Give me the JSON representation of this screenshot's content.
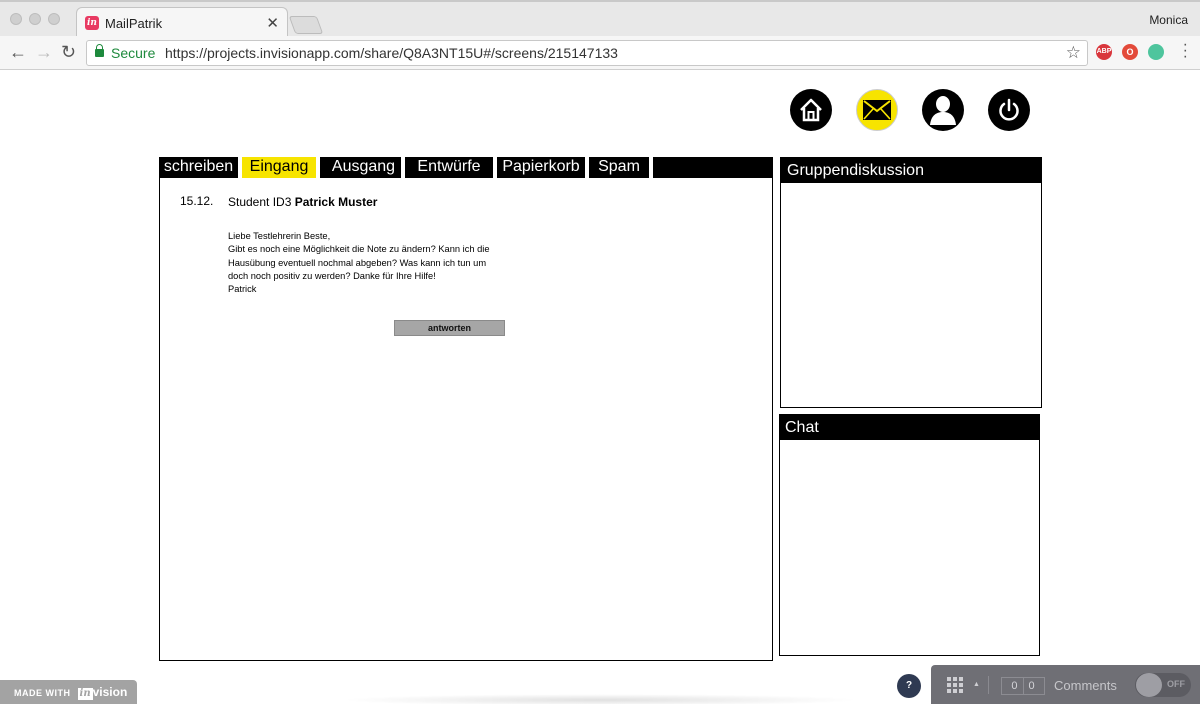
{
  "browser": {
    "tab_title": "MailPatrik",
    "tab_favicon": "in",
    "tab_close": "✕",
    "profile_name": "Monica",
    "secure_label": "Secure",
    "url": "https://projects.invisionapp.com/share/Q8A3NT15U#/screens/215147133",
    "extensions": [
      {
        "name": "adblock-plus",
        "label": "ABP",
        "color": "#d9363c"
      },
      {
        "name": "opera-extension",
        "label": "O",
        "color": "#e34a3a"
      },
      {
        "name": "grammarly-extension",
        "label": "",
        "color": "#4ec59d"
      }
    ]
  },
  "app": {
    "top_icons": [
      {
        "name": "home-icon",
        "active": false
      },
      {
        "name": "mail-icon",
        "active": true
      },
      {
        "name": "user-icon",
        "active": false
      },
      {
        "name": "power-icon",
        "active": false
      }
    ],
    "mail_tabs": [
      "schreiben",
      "Eingang",
      "Ausgang",
      "Entwürfe",
      "Papierkorb",
      "Spam"
    ],
    "active_tab": "Eingang",
    "message": {
      "date": "15.12.",
      "sender_prefix": "Student ID3",
      "sender_name": "Patrick Muster",
      "lines": [
        "Liebe Testlehrerin Beste,",
        "Gibt es noch eine Möglichkeit die Note zu ändern? Kann ich die",
        "Hausübung eventuell nochmal abgeben? Was kann ich tun um",
        "doch noch positiv zu werden? Danke für Ihre Hilfe!",
        "Patrick"
      ],
      "reply_button": "antworten"
    },
    "group_panel_title": "Gruppendiskussion",
    "chat_panel_title": "Chat"
  },
  "invision": {
    "made_with": "MADE WITH",
    "logo_in": "in",
    "logo_text": "vision",
    "help": "?",
    "comment_count_left": "0",
    "comment_count_right": "0",
    "comments_label": "Comments",
    "toggle_state": "OFF"
  }
}
